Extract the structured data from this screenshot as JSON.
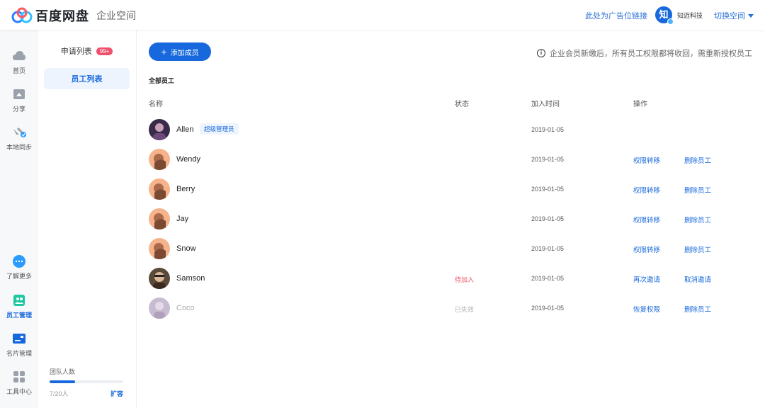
{
  "header": {
    "logo_text": "百度网盘",
    "workspace_label": "企业空间",
    "ad_link": "此处为广告位链接",
    "org_avatar_char": "知",
    "org_name": "知迈科技",
    "switch_space": "切换空间"
  },
  "rail": {
    "items": [
      {
        "label": "首页",
        "icon": "home-cloud-icon"
      },
      {
        "label": "分享",
        "icon": "share-icon"
      },
      {
        "label": "本地同步",
        "icon": "sync-icon"
      },
      {
        "label": "了解更多",
        "icon": "more-icon"
      },
      {
        "label": "员工管理",
        "icon": "staff-icon"
      },
      {
        "label": "名片管理",
        "icon": "card-icon"
      },
      {
        "label": "工具中心",
        "icon": "tools-icon"
      }
    ]
  },
  "subnav": {
    "apply_list": "申请列表",
    "apply_badge": "99+",
    "staff_list": "员工列表",
    "team_title": "团队人数",
    "team_count": "7/20人",
    "team_fill": 0.35,
    "expand": "扩容"
  },
  "main": {
    "add_member": "添加成员",
    "notice": "企业会员新缴后，所有员工权限都将收回，需重新授权员工",
    "section_title": "全部员工",
    "columns": {
      "name": "名称",
      "status": "状态",
      "time": "加入时间",
      "op": "操作"
    },
    "rows": [
      {
        "name": "Allen",
        "role": "超级管理员",
        "status": "",
        "time": "2019-01-05",
        "op1": "",
        "op2": ""
      },
      {
        "name": "Wendy",
        "role": "",
        "status": "",
        "time": "2019-01-05",
        "op1": "权限转移",
        "op2": "删除员工"
      },
      {
        "name": "Berry",
        "role": "",
        "status": "",
        "time": "2019-01-05",
        "op1": "权限转移",
        "op2": "删除员工"
      },
      {
        "name": "Jay",
        "role": "",
        "status": "",
        "time": "2019-01-05",
        "op1": "权限转移",
        "op2": "删除员工"
      },
      {
        "name": "Snow",
        "role": "",
        "status": "",
        "time": "2019-01-05",
        "op1": "权限转移",
        "op2": "删除员工"
      },
      {
        "name": "Samson",
        "role": "",
        "status": "待加入",
        "time": "2019-01-05",
        "op1": "再次邀请",
        "op2": "取消邀请"
      },
      {
        "name": "Coco",
        "role": "",
        "status": "已失效",
        "time": "2019-01-05",
        "op1": "恢复权限",
        "op2": "删除员工"
      }
    ]
  },
  "colors": {
    "accent": "#1668dc",
    "pending": "#f0506e",
    "expired": "#b0b0b0"
  }
}
